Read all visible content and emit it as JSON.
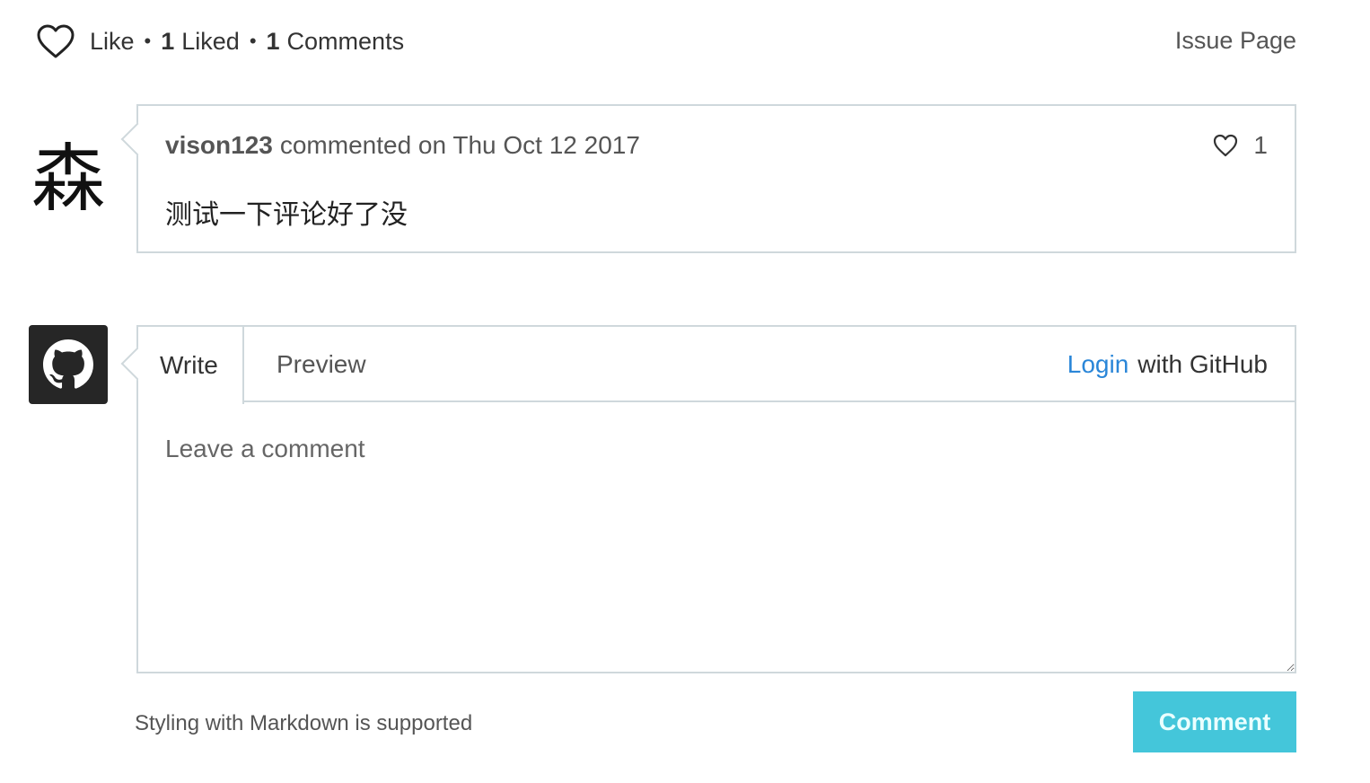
{
  "meta": {
    "like_label": "Like",
    "separator": "•",
    "liked_count": "1",
    "liked_label": "Liked",
    "comments_count": "1",
    "comments_label": "Comments",
    "issue_page_label": "Issue Page"
  },
  "comment": {
    "avatar_char": "森",
    "author": "vison123",
    "action": "commented on Thu Oct 12 2017",
    "like_count": "1",
    "body": "测试一下评论好了没"
  },
  "editor": {
    "tabs": [
      {
        "label": "Write"
      },
      {
        "label": "Preview"
      }
    ],
    "login_link": "Login",
    "login_suffix": "with GitHub",
    "placeholder": "Leave a comment"
  },
  "footer": {
    "markdown_note": "Styling with Markdown is supported",
    "comment_button": "Comment"
  },
  "colors": {
    "link": "#2a86d8",
    "button": "#44c6da",
    "border": "#cfd8dc",
    "github_avatar_bg": "#262626"
  }
}
